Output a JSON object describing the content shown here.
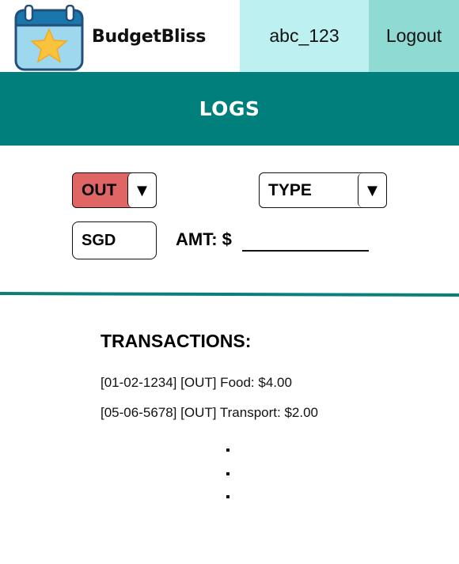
{
  "header": {
    "brand_name": "BudgetBliss",
    "logo_icon": "calendar-star-icon",
    "username": "abc_123",
    "logout_label": "Logout"
  },
  "banner": {
    "title": "LOGS"
  },
  "form": {
    "direction": {
      "value": "OUT",
      "arrow": "▼",
      "color": "#e06666"
    },
    "type": {
      "value": "TYPE",
      "arrow": "▼"
    },
    "currency": {
      "value": "SGD"
    },
    "amount": {
      "label": "AMT: $",
      "value": ""
    }
  },
  "transactions": {
    "title": "TRANSACTIONS:",
    "items": [
      "[01-02-1234] [OUT] Food: $4.00",
      "[05-06-5678] [OUT] Transport: $2.00"
    ]
  },
  "colors": {
    "teal_banner": "#007f7d",
    "user_box": "#bdf1f1",
    "logout_box": "#90dad4",
    "out_red": "#e06666"
  }
}
